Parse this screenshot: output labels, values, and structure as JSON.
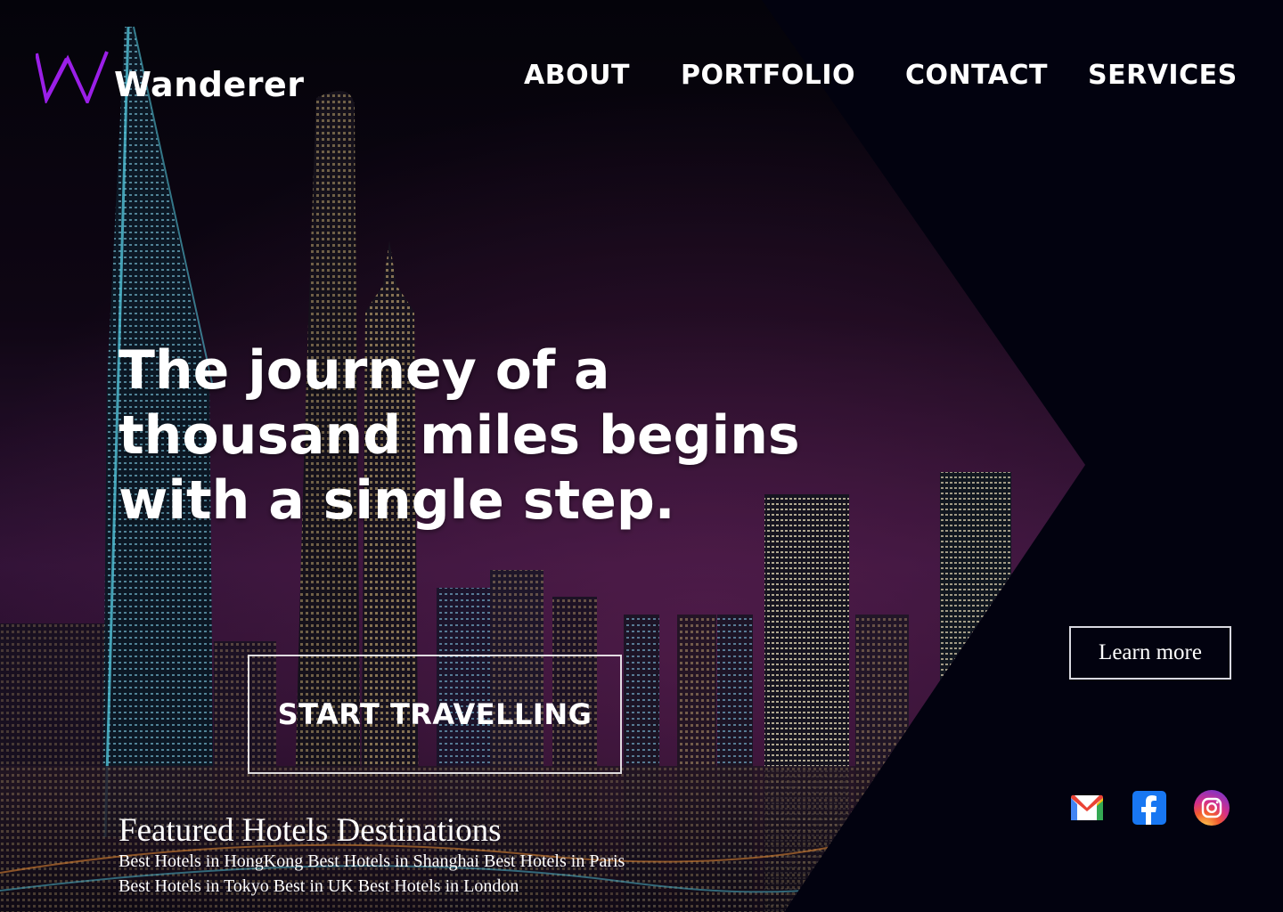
{
  "brand": {
    "name": "Wanderer",
    "logo_icon": "w-zigzag-logo",
    "logo_color": "#9b1fe8"
  },
  "nav": {
    "items": [
      "ABOUT",
      "PORTFOLIO",
      "CONTACT",
      "SERVICES"
    ]
  },
  "hero": {
    "headline": "The journey of a thousand miles begins with a single step.",
    "cta_label": "START TRAVELLING"
  },
  "learn_more": {
    "label": "Learn more"
  },
  "featured": {
    "title": "Featured Hotels Destinations",
    "links": [
      "Best Hotels in HongKong",
      "Best Hotels in Shanghai",
      "Best Hotels in Paris",
      "Best Hotels in Tokyo",
      "Best in UK",
      "Best Hotels in London"
    ]
  },
  "social": [
    {
      "icon": "gmail-icon"
    },
    {
      "icon": "facebook-icon",
      "color": "#1877f2"
    },
    {
      "icon": "instagram-icon"
    }
  ],
  "colors": {
    "background": "#02020f",
    "accent": "#9b1fe8",
    "text": "#ffffff"
  }
}
